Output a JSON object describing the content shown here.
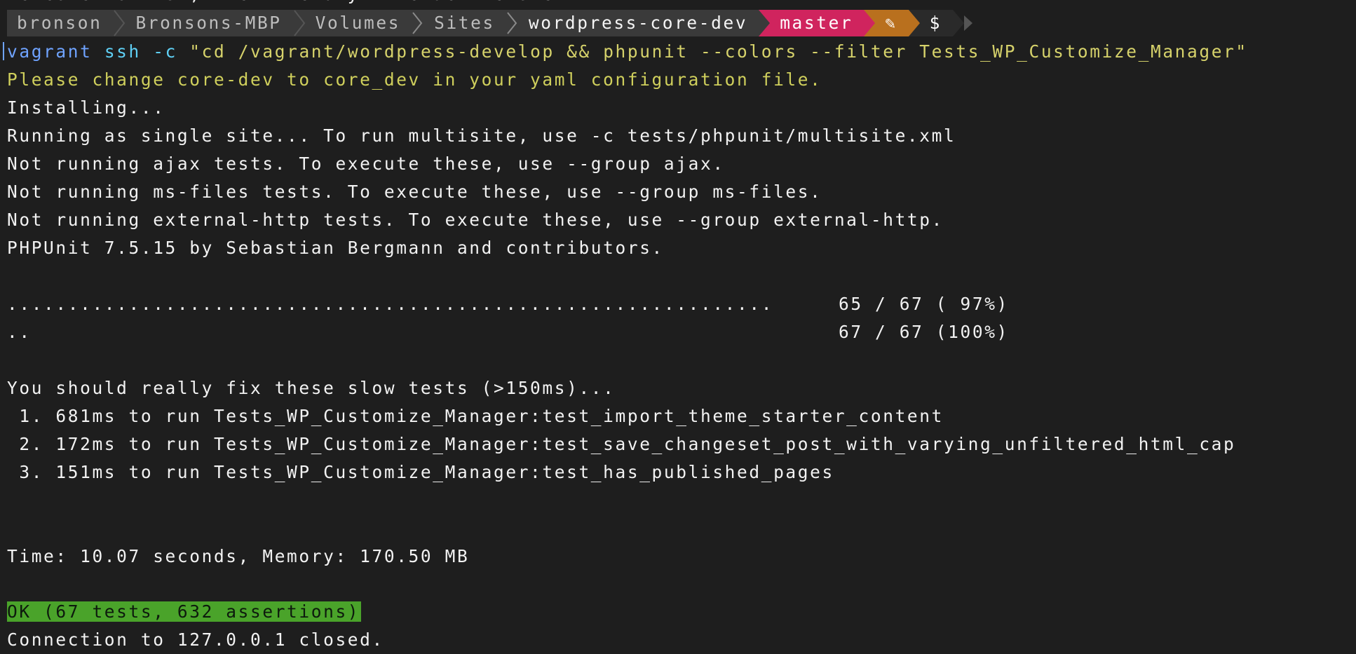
{
  "terminal": {
    "partial_top_line": "Welcome to fish, the friendly interactive shell",
    "prompt": {
      "user": "bronson",
      "host": "Bronsons-MBP",
      "path": [
        "Volumes",
        "Sites",
        "wordpress-core-dev"
      ],
      "branch": "master",
      "status_glyph": "✎",
      "symbol": "$",
      "colors": {
        "segment_gray": "#3a3a3a",
        "branch_pink": "#d0245e",
        "status_orange": "#b9701e"
      }
    },
    "command": {
      "program": "vagrant",
      "subcommand": "ssh",
      "flag": "-c",
      "argument": "\"cd /vagrant/wordpress-develop && phpunit --colors --filter Tests_WP_Customize_Manager\""
    },
    "output": {
      "warning": "Please change core-dev to core_dev in your yaml configuration file.",
      "installing": "Installing...",
      "single_site": "Running as single site... To run multisite, use -c tests/phpunit/multisite.xml",
      "ajax": "Not running ajax tests. To execute these, use --group ajax.",
      "ms_files": "Not running ms-files tests. To execute these, use --group ms-files.",
      "external_http": "Not running external-http tests. To execute these, use --group external-http.",
      "phpunit_version": "PHPUnit 7.5.15 by Sebastian Bergmann and contributors.",
      "progress": [
        {
          "dots": "...............................................................",
          "count": "65 / 67 ( 97%)"
        },
        {
          "dots": "..",
          "count": "67 / 67 (100%)"
        }
      ],
      "slow_header": "You should really fix these slow tests (>150ms)...",
      "slow_tests": [
        " 1. 681ms to run Tests_WP_Customize_Manager:test_import_theme_starter_content",
        " 2. 172ms to run Tests_WP_Customize_Manager:test_save_changeset_post_with_varying_unfiltered_html_cap",
        " 3. 151ms to run Tests_WP_Customize_Manager:test_has_published_pages"
      ],
      "time_memory": "Time: 10.07 seconds, Memory: 170.50 MB",
      "ok_summary": "OK (67 tests, 632 assertions)",
      "ok_color": "#4aa32a",
      "connection_closed": "Connection to 127.0.0.1 closed."
    }
  }
}
